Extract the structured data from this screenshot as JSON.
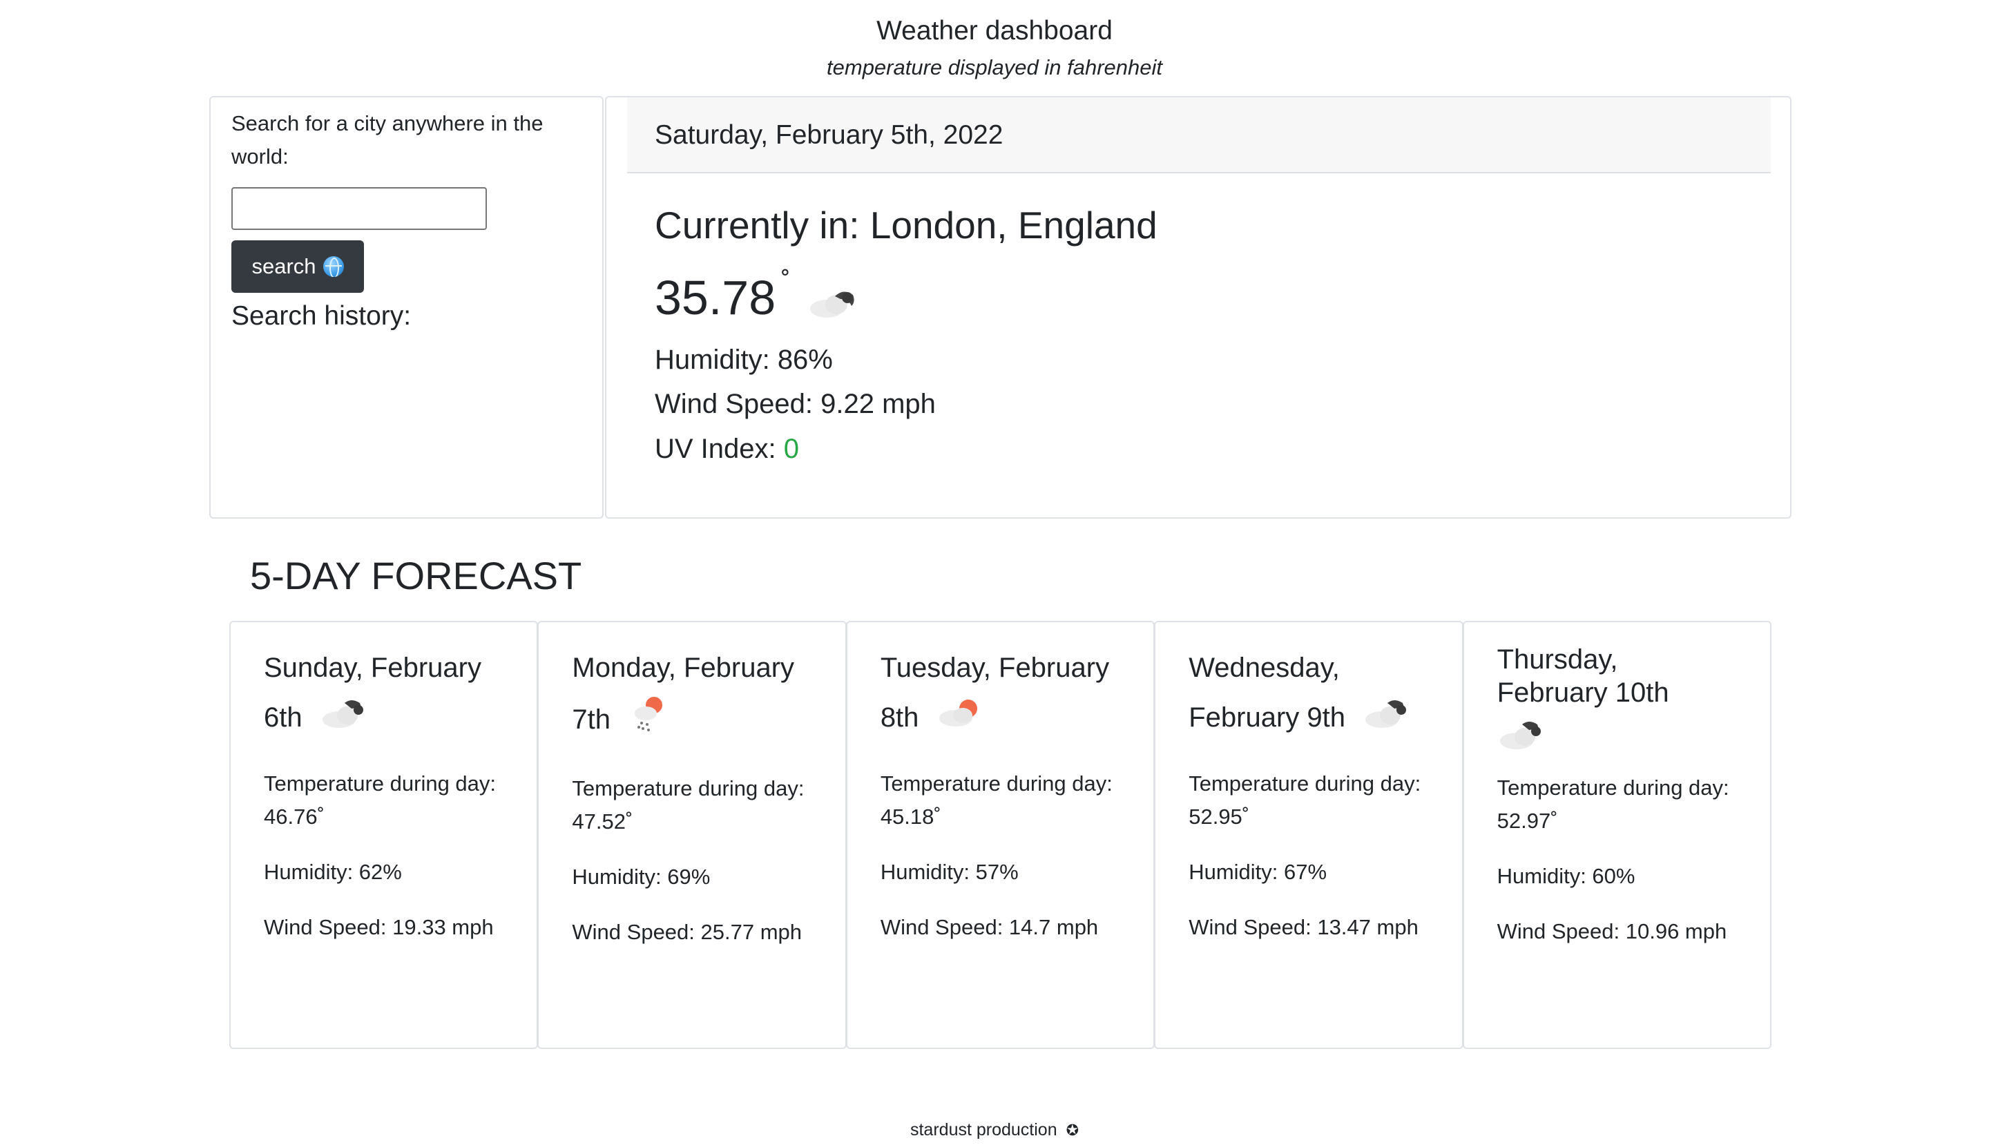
{
  "header": {
    "title": "Weather dashboard",
    "subtitle": "temperature displayed in fahrenheit"
  },
  "search": {
    "prompt": "Search for a city anywhere in the world:",
    "input_value": "",
    "button_label": "search",
    "button_icon": "globe-icon",
    "history_heading": "Search history:"
  },
  "current": {
    "date": "Saturday, February 5th, 2022",
    "city": "Currently in: London, England",
    "temperature": "35.78",
    "degree_symbol": "˚",
    "icon": "cloud-moon-icon",
    "humidity": "Humidity: 86%",
    "wind": "Wind Speed: 9.22 mph",
    "uv_label": "UV Index: ",
    "uv_value": "0",
    "uv_color": "#28a745"
  },
  "forecast": {
    "heading": "5-DAY FORECAST",
    "days": [
      {
        "title_line1": "Sunday, February",
        "title_line2": "6th",
        "icon": "cloud-moon-icon",
        "temp": "Temperature during day: 46.76˚",
        "humidity": "Humidity: 62%",
        "wind": "Wind Speed: 19.33 mph"
      },
      {
        "title_line1": "Monday, February",
        "title_line2": "7th",
        "icon": "rain-sun-icon",
        "temp": "Temperature during day: 47.52˚",
        "humidity": "Humidity: 69%",
        "wind": "Wind Speed: 25.77 mph"
      },
      {
        "title_line1": "Tuesday, February",
        "title_line2": "8th",
        "icon": "cloud-sun-icon",
        "temp": "Temperature during day: 45.18˚",
        "humidity": "Humidity: 57%",
        "wind": "Wind Speed: 14.7 mph"
      },
      {
        "title_line1": "Wednesday,",
        "title_line2": "February 9th",
        "icon": "cloud-moon-icon",
        "temp": "Temperature during day: 52.95˚",
        "humidity": "Humidity: 67%",
        "wind": "Wind Speed: 13.47 mph"
      },
      {
        "title_line1": "Thursday,",
        "title_line2": "February 10th",
        "icon": "cloud-moon-icon",
        "temp": "Temperature during day: 52.97˚",
        "humidity": "Humidity: 60%",
        "wind": "Wind Speed: 10.96 mph"
      }
    ]
  },
  "footer": {
    "text": "stardust production",
    "icon": "star-icon"
  }
}
